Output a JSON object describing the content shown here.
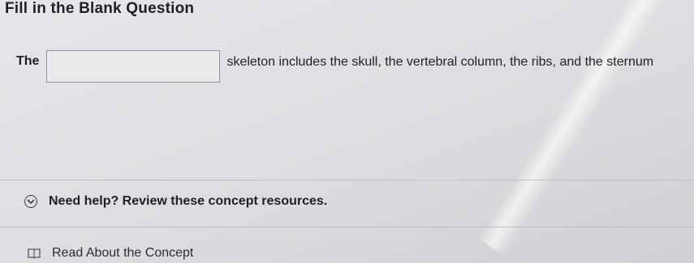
{
  "question": {
    "title": "Fill in the Blank Question",
    "sentence_start": "The",
    "blank_value": "",
    "sentence_end": "skeleton includes the skull, the vertebral column, the ribs, and the sternum"
  },
  "help": {
    "toggle_icon": "chevron-down-circle-icon",
    "label": "Need help? Review these concept resources."
  },
  "resources": [
    {
      "icon": "book-icon",
      "label": "Read About the Concept"
    }
  ]
}
